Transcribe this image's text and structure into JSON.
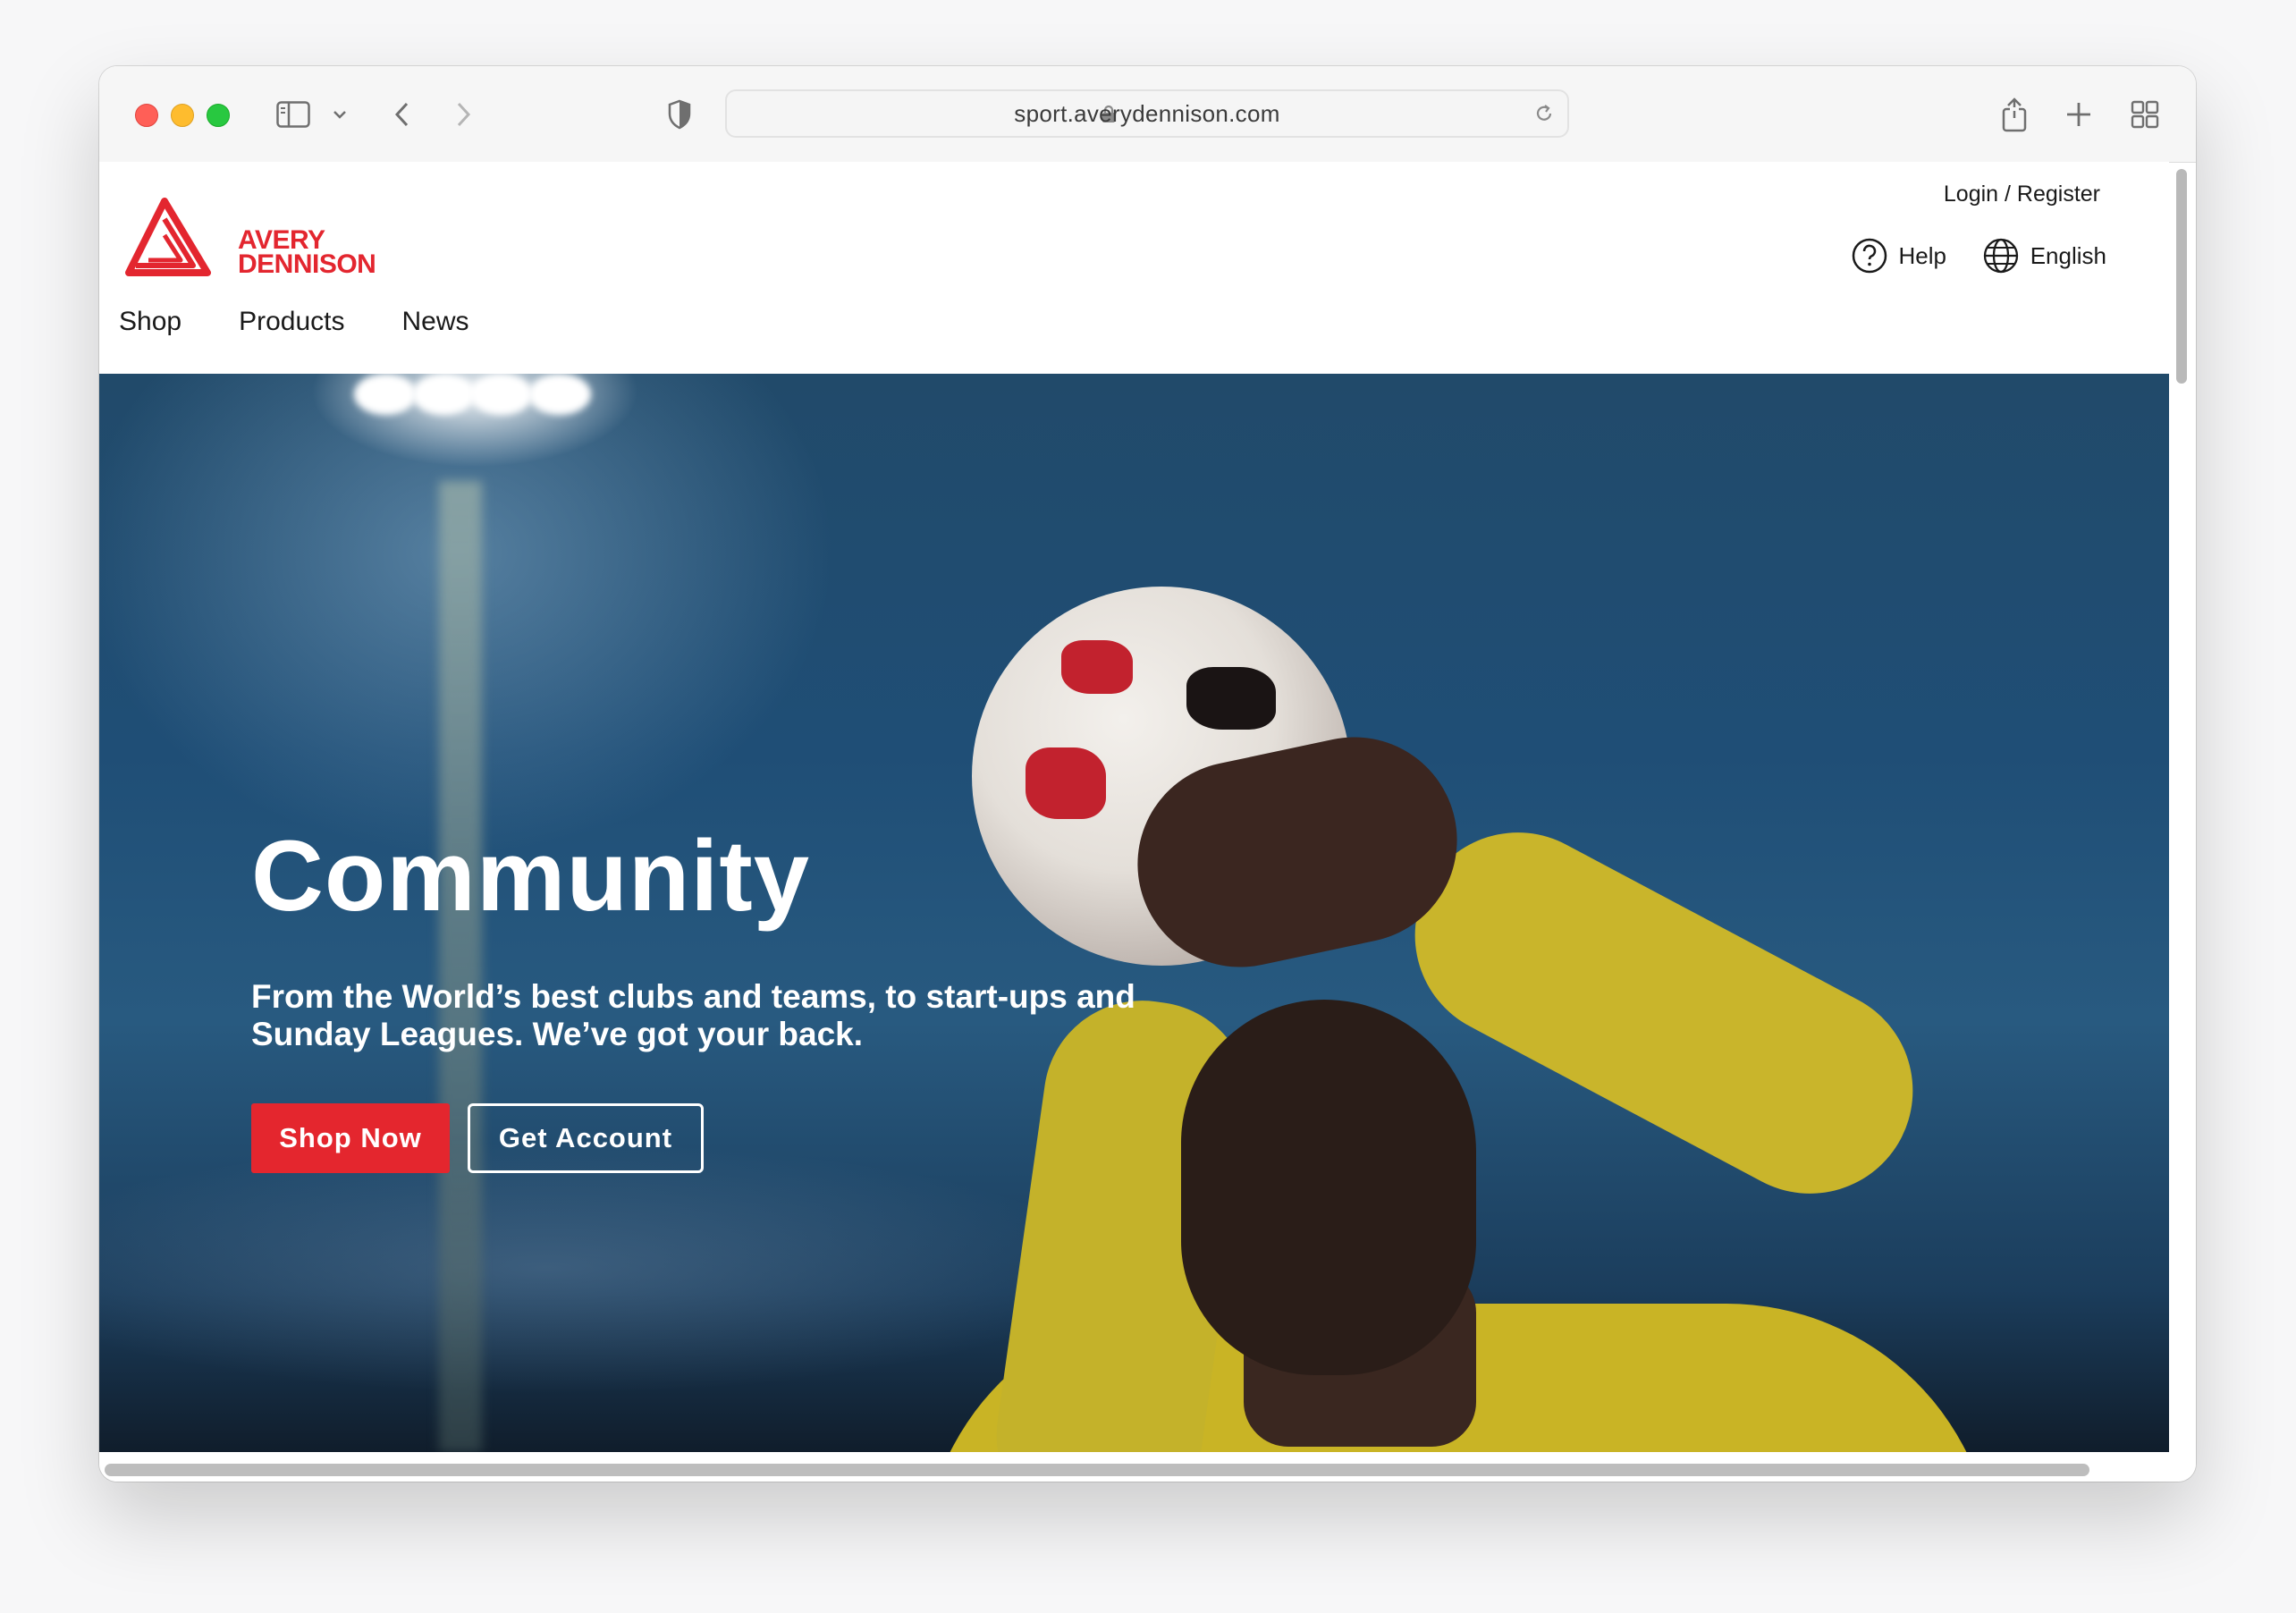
{
  "browser": {
    "url": "sport.averydennison.com"
  },
  "site": {
    "logo_line1": "AVERY",
    "logo_line2": "DENNISON",
    "nav": [
      "Shop",
      "Products",
      "News"
    ],
    "login_register": "Login / Register",
    "help": "Help",
    "language": "English"
  },
  "hero": {
    "title": "Community",
    "subtitle": "From the World’s best clubs and teams, to start-ups and Sunday Leagues. We’ve got your back.",
    "primary_button": "Shop Now",
    "secondary_button": "Get Account"
  },
  "colors": {
    "brand_red": "#e4262e",
    "hero_sky": "#1f4e76"
  }
}
